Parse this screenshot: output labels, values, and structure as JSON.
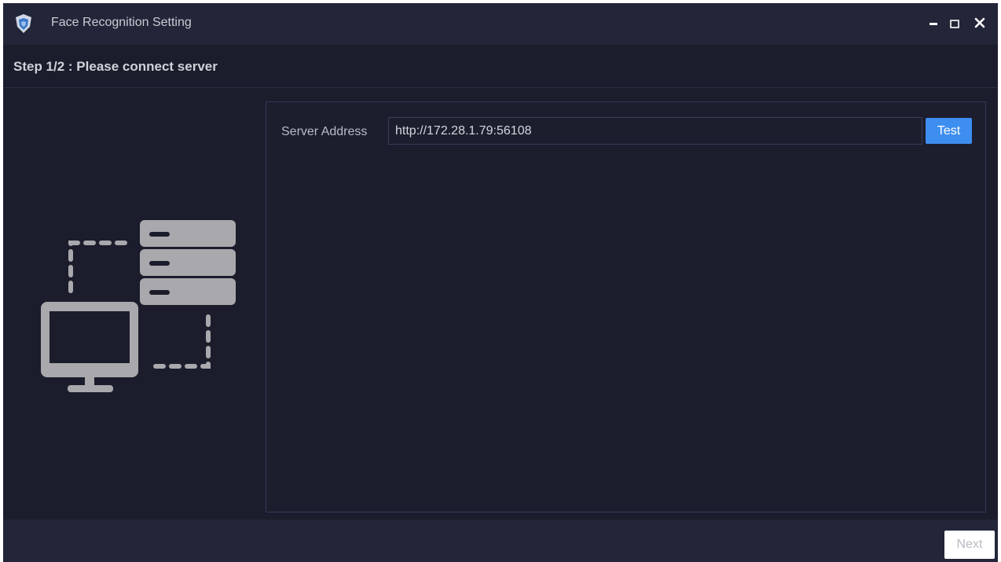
{
  "window": {
    "title": "Face Recognition Setting",
    "app_icon": "shield-cube-icon",
    "controls": {
      "minimize_icon": "minimize-icon",
      "maximize_icon": "maximize-icon",
      "close_icon": "close-icon"
    }
  },
  "step": {
    "title": "Step 1/2 : Please connect server"
  },
  "illustration": {
    "icon": "computer-server-connection-icon"
  },
  "form": {
    "server_address_label": "Server Address",
    "server_address_value": "http://172.28.1.79:56108",
    "test_label": "Test"
  },
  "footer": {
    "next_label": "Next"
  },
  "colors": {
    "background": "#1b1d2c",
    "titlebar": "#232638",
    "accent": "#3e8ef0",
    "illustration": "#a9a9ad"
  }
}
